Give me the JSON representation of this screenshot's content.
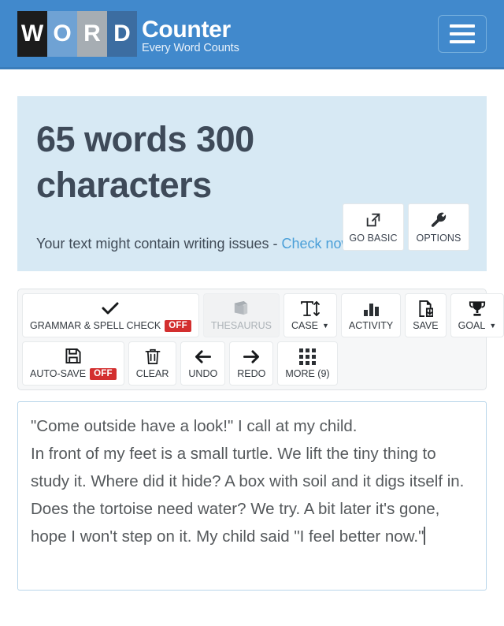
{
  "header": {
    "logo_tiles": [
      "W",
      "O",
      "R",
      "D"
    ],
    "brand_name": "Counter",
    "tagline": "Every Word Counts",
    "menu_icon": "hamburger-menu-icon",
    "background_color": "#4189cc"
  },
  "summary": {
    "counts_text": "65 words 300 characters",
    "word_count": 65,
    "character_count": 300,
    "background_color": "#d7e9f4",
    "actions": [
      {
        "label": "GO BASIC",
        "icon": "external-link-icon"
      },
      {
        "label": "OPTIONS",
        "icon": "wrench-icon"
      }
    ],
    "issues_text": "Your text might contain writing issues - ",
    "issues_link": "Check now",
    "issues_link_color": "#4a9fd8"
  },
  "toolbar": {
    "row1": [
      {
        "label": "GRAMMAR & SPELL CHECK",
        "icon": "checkmark-icon",
        "badge": "OFF",
        "disabled": false
      },
      {
        "label": "THESAURUS",
        "icon": "book-icon",
        "badge": null,
        "disabled": true
      },
      {
        "label": "CASE",
        "icon": "text-height-icon",
        "badge": null,
        "caret": true,
        "disabled": false
      },
      {
        "label": "ACTIVITY",
        "icon": "bar-chart-icon",
        "badge": null,
        "disabled": false
      },
      {
        "label": "SAVE",
        "icon": "file-save-icon",
        "badge": null,
        "disabled": false
      },
      {
        "label": "GOAL",
        "icon": "trophy-icon",
        "badge": null,
        "caret": true,
        "disabled": false
      }
    ],
    "row2": [
      {
        "label": "AUTO-SAVE",
        "icon": "floppy-disk-icon",
        "badge": "OFF",
        "disabled": false
      },
      {
        "label": "CLEAR",
        "icon": "trash-icon",
        "badge": null,
        "disabled": false
      },
      {
        "label": "UNDO",
        "icon": "arrow-left-icon",
        "badge": null,
        "disabled": false
      },
      {
        "label": "REDO",
        "icon": "arrow-right-icon",
        "badge": null,
        "disabled": false
      },
      {
        "label": "MORE (9)",
        "icon": "grid-icon",
        "badge": null,
        "disabled": false
      }
    ],
    "badge_color": "#d32f2f"
  },
  "editor": {
    "content": "\"Come outside have a look!\" I call at my child.\nIn front of my feet is a small turtle. We lift the tiny thing to study it. Where did it hide? A box with soil and it digs itself in. Does the tortoise need water? We try. A bit later it's gone, hope I won't step on it. My child said \"I feel better now.\"",
    "placeholder": "",
    "cursor_visible": true,
    "border_color": "#b9d6ea"
  }
}
